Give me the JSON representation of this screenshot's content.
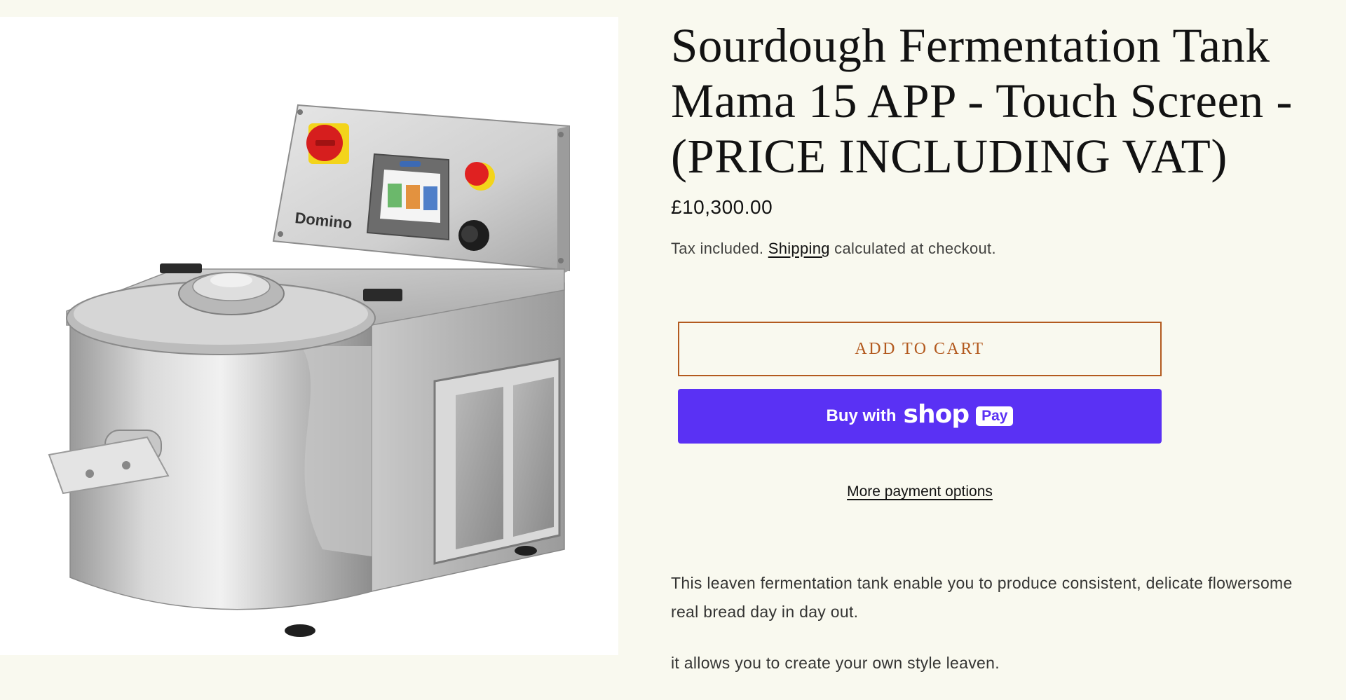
{
  "product": {
    "title": "Sourdough Fermentation Tank Mama 15 APP - Touch Screen - (PRICE INCLUDING VAT)",
    "price": "£10,300.00",
    "tax_prefix": "Tax included. ",
    "shipping_link": "Shipping",
    "tax_suffix": " calculated at checkout.",
    "add_to_cart_label": "Add to cart",
    "buy_with_label": "Buy with",
    "shop_label": "shop",
    "pay_label": "Pay",
    "more_payment_options_label": "More payment options",
    "description": [
      "This leaven fermentation tank enable you to produce consistent, delicate flowersome real bread day in day out.",
      "it allows you to create your own style leaven."
    ]
  },
  "image": {
    "brand_text": "Domino",
    "alt": "Sourdough Fermentation Tank Mama 15 APP"
  },
  "colors": {
    "page_bg": "#f9f9ef",
    "accent": "#b35a1f",
    "shop_pay": "#5a31f4"
  },
  "icons": [
    "emergency-stop-icon",
    "touchscreen-panel-icon",
    "control-knob-icon"
  ]
}
